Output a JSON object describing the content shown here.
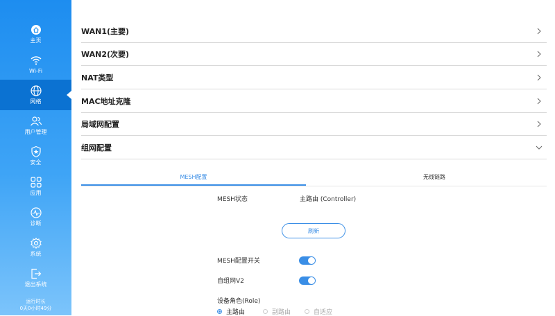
{
  "sidebar": {
    "items": [
      {
        "label": "主页",
        "icon": "home-icon"
      },
      {
        "label": "Wi-Fi",
        "icon": "wifi-icon"
      },
      {
        "label": "网络",
        "icon": "globe-icon",
        "active": true
      },
      {
        "label": "用户管理",
        "icon": "users-icon"
      },
      {
        "label": "安全",
        "icon": "shield-star-icon"
      },
      {
        "label": "应用",
        "icon": "apps-grid-icon"
      },
      {
        "label": "诊断",
        "icon": "pulse-icon"
      },
      {
        "label": "系统",
        "icon": "gear-icon"
      },
      {
        "label": "退出系统",
        "icon": "logout-icon"
      }
    ],
    "uptime_label": "运行时长",
    "uptime_value": "0天0小时49分"
  },
  "sections": [
    {
      "title": "WAN1(主要)",
      "expanded": false
    },
    {
      "title": "WAN2(次要)",
      "expanded": false
    },
    {
      "title": "NAT类型",
      "expanded": false
    },
    {
      "title": "MAC地址克隆",
      "expanded": false
    },
    {
      "title": "局域网配置",
      "expanded": false
    },
    {
      "title": "组网配置",
      "expanded": true
    }
  ],
  "tabs": [
    {
      "label": "MESH配置",
      "active": true
    },
    {
      "label": "无线链路",
      "active": false
    }
  ],
  "mesh": {
    "status_label": "MESH状态",
    "status_value": "主路由 (Controller)",
    "refresh_label": "刷新",
    "switch_label": "MESH配置开关",
    "switch_on": true,
    "v2_label": "自组网V2",
    "v2_on": true,
    "role_label": "设备角色(Role)",
    "roles": [
      {
        "label": "主路由",
        "checked": true
      },
      {
        "label": "副路由",
        "checked": false
      },
      {
        "label": "自适应",
        "checked": false
      }
    ]
  },
  "colors": {
    "accent": "#3a8ee6",
    "sidebar_active": "#0b72d2",
    "sidebar_top": "#1d8df0",
    "sidebar_bottom": "#7cc4fb"
  }
}
